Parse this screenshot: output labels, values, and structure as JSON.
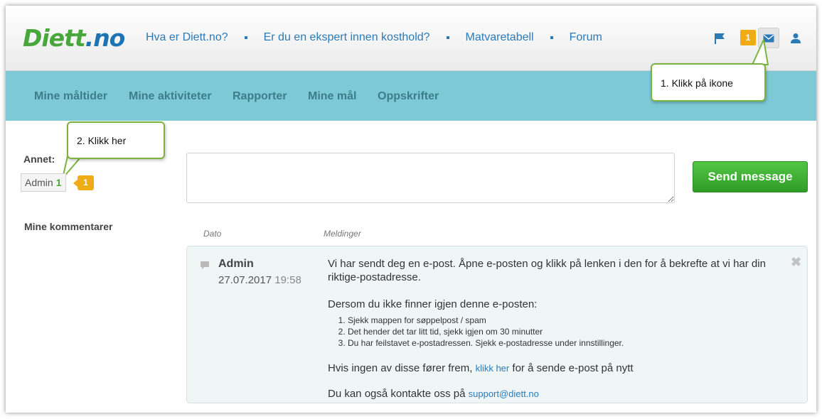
{
  "header": {
    "logo_main": "Diett",
    "logo_dot": ".",
    "logo_tld": "no",
    "nav": [
      "Hva er Diett.no?",
      "Er du en ekspert innen kosthold?",
      "Matvaretabell",
      "Forum"
    ],
    "badge_count": "1",
    "icons": [
      "flag-icon",
      "mail-icon",
      "user-icon"
    ]
  },
  "subnav": {
    "items": [
      "Mine måltider",
      "Mine aktiviteter",
      "Rapporter",
      "Mine mål",
      "Oppskrifter"
    ]
  },
  "callouts": {
    "one": "1. Klikk på ikone",
    "two": "2. Klikk her"
  },
  "sidebar": {
    "annet_label": "Annet:",
    "admin_label": "Admin",
    "admin_count": "1",
    "admin_badge": "1",
    "comments_label": "Mine kommentarer"
  },
  "form": {
    "message_value": "",
    "send_label": "Send message"
  },
  "table": {
    "col_date": "Dato",
    "col_messages": "Meldinger"
  },
  "message": {
    "sender": "Admin",
    "date": "27.07.2017",
    "time": "19:58",
    "para1": "Vi har sendt deg en e-post. Åpne e-posten og klikk på lenken i den for å bekrefte at vi har din riktige-postadresse.",
    "para2": "Dersom du ikke finner igjen denne e-posten:",
    "list": [
      "Sjekk mappen for søppelpost / spam",
      "Det hender det tar litt tid, sjekk igjen om 30 minutter",
      "Du har feilstavet e-postadressen. Sjekk e-postadresse under innstillinger."
    ],
    "para3_before": "Hvis ingen av disse fører frem, ",
    "para3_link": "klikk her",
    "para3_after": " for å sende e-post på nytt",
    "para4_before": "Du kan også kontakte oss på ",
    "para4_link": "support@diett.no"
  },
  "colors": {
    "brand_green": "#47a73a",
    "brand_blue": "#1d74b5",
    "subnav_bg": "#7dcad6",
    "badge_orange": "#f0ac14",
    "button_green": "#3aaa2f",
    "callout_border": "#7bb33f"
  }
}
